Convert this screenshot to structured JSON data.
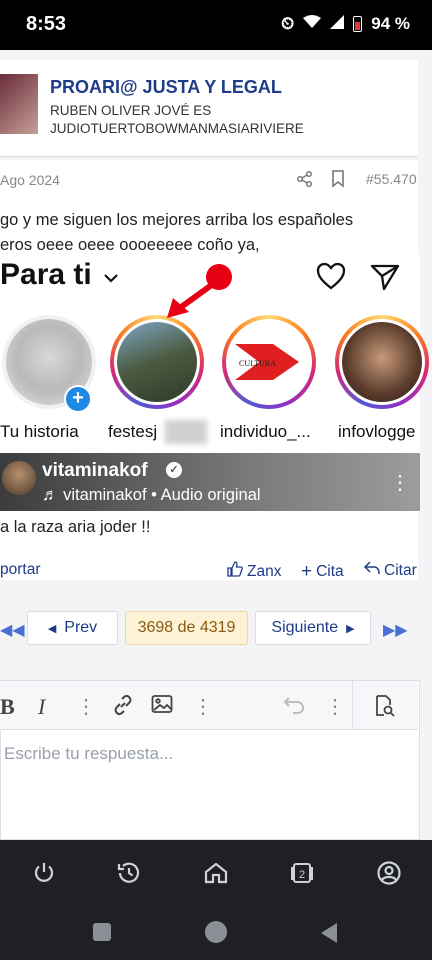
{
  "status": {
    "time": "8:53",
    "battery": "94 %"
  },
  "thread": {
    "title": "PROARI@ JUSTA Y LEGAL",
    "subtitle_line1": "RUBEN OLIVER JOVÉ ES",
    "subtitle_line2": "JUDIOTUERTOBOWMANMASIARIVIERE"
  },
  "post": {
    "date": "Ago 2024",
    "number": "#55.470",
    "text_line1": "go y me siguen los mejores arriba los españoles",
    "text_line2": "eros oeee oeee oooeeeee coño ya,",
    "text_after": "a la raza aria joder !!",
    "report_label": "portar",
    "like_label": "Zanx",
    "quote_label": "Cita",
    "reply_label": "Citar"
  },
  "instagram": {
    "header_title": "Para ti",
    "stories": [
      {
        "label": "Tu historia"
      },
      {
        "label": "festesj"
      },
      {
        "label": "individuo_..."
      },
      {
        "label": "infovlogge"
      }
    ],
    "reel_user": "vitaminakof",
    "reel_audio": "vitaminakof • Audio original"
  },
  "pagination": {
    "prev": "Prev",
    "current": "3698 de 4319",
    "next": "Siguiente"
  },
  "editor": {
    "placeholder": "Escribe tu respuesta..."
  }
}
